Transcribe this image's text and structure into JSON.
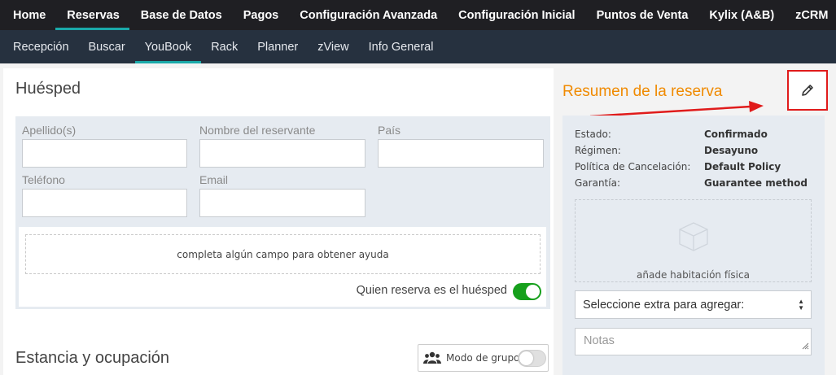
{
  "topnav": {
    "items": [
      {
        "label": "Home",
        "active": false
      },
      {
        "label": "Reservas",
        "active": true
      },
      {
        "label": "Base de Datos",
        "active": false
      },
      {
        "label": "Pagos",
        "active": false
      },
      {
        "label": "Configuración Avanzada",
        "active": false
      },
      {
        "label": "Configuración Inicial",
        "active": false
      },
      {
        "label": "Puntos de Venta",
        "active": false
      },
      {
        "label": "Kylix (A&B)",
        "active": false
      },
      {
        "label": "zCRM",
        "active": false
      }
    ]
  },
  "subnav": {
    "items": [
      {
        "label": "Recepción",
        "active": false
      },
      {
        "label": "Buscar",
        "active": false
      },
      {
        "label": "YouBook",
        "active": true
      },
      {
        "label": "Rack",
        "active": false
      },
      {
        "label": "Planner",
        "active": false
      },
      {
        "label": "zView",
        "active": false
      },
      {
        "label": "Info General",
        "active": false
      }
    ]
  },
  "guest": {
    "title": "Huésped",
    "fields": {
      "surname": {
        "label": "Apellido(s)",
        "value": ""
      },
      "booker_name": {
        "label": "Nombre del reservante",
        "value": ""
      },
      "country": {
        "label": "País",
        "value": ""
      },
      "phone": {
        "label": "Teléfono",
        "value": ""
      },
      "email": {
        "label": "Email",
        "value": ""
      }
    },
    "help_text": "completa algún campo para obtener ayuda",
    "booker_is_guest_label": "Quien reserva es el huésped",
    "booker_is_guest": true
  },
  "stay": {
    "title": "Estancia y ocupación",
    "group_mode_label": "Modo de grupo",
    "group_mode": false
  },
  "summary": {
    "title": "Resumen de la reserva",
    "rows": [
      {
        "key": "Estado:",
        "value": "Confirmado"
      },
      {
        "key": "Régimen:",
        "value": "Desayuno"
      },
      {
        "key": "Política de Cancelación:",
        "value": "Default Policy"
      },
      {
        "key": "Garantía:",
        "value": "Guarantee method"
      }
    ],
    "add_room_label": "añade habitación física",
    "extra_select_value": "Seleccione extra para agregar:",
    "notes_placeholder": "Notas"
  },
  "colors": {
    "accent": "#1aa9a9",
    "annotation": "#f08a00",
    "highlight": "#e01b1b",
    "toggle_on": "#16a01c"
  }
}
